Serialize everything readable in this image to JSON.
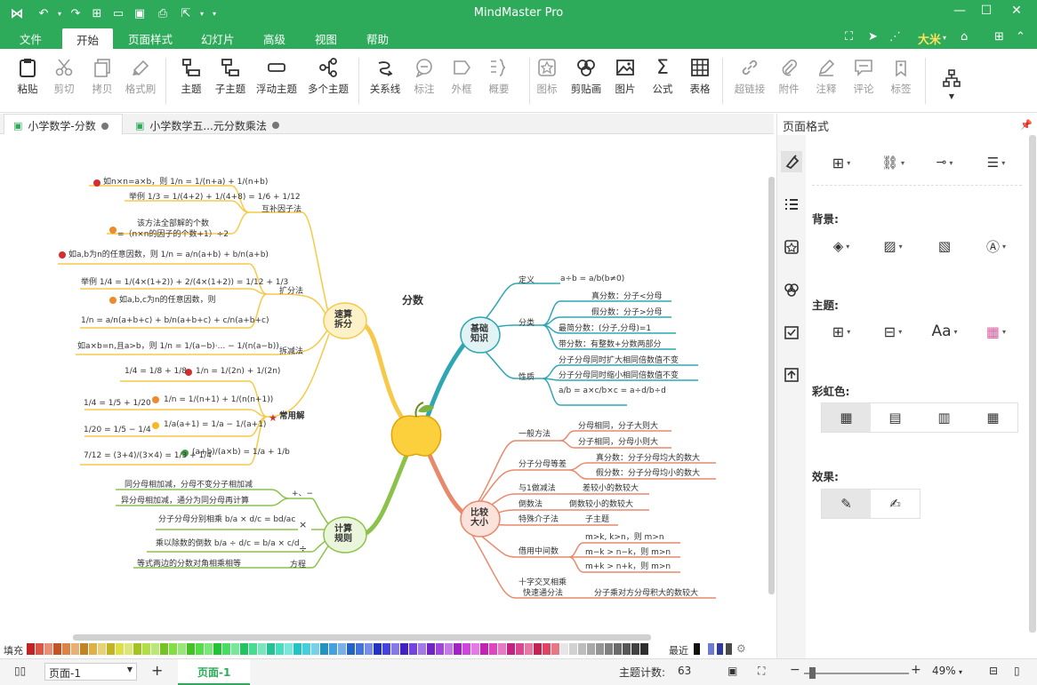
{
  "app": {
    "title": "MindMaster Pro",
    "user": "大米"
  },
  "menu": {
    "items": [
      "文件",
      "开始",
      "页面样式",
      "幻灯片",
      "高级",
      "视图",
      "帮助"
    ],
    "active": 1
  },
  "ribbon": {
    "buttons": [
      {
        "label": "粘贴",
        "icon": "clipboard-icon",
        "disabled": false
      },
      {
        "label": "剪切",
        "icon": "scissors-icon",
        "disabled": true
      },
      {
        "label": "拷贝",
        "icon": "copy-icon",
        "disabled": true
      },
      {
        "label": "格式刷",
        "icon": "format-brush-icon",
        "disabled": true
      },
      {
        "label": "主题",
        "icon": "topic-icon",
        "disabled": false
      },
      {
        "label": "子主题",
        "icon": "subtopic-icon",
        "disabled": false
      },
      {
        "label": "浮动主题",
        "icon": "floating-topic-icon",
        "disabled": false
      },
      {
        "label": "多个主题",
        "icon": "multiple-topics-icon",
        "disabled": false
      },
      {
        "label": "关系线",
        "icon": "relationship-icon",
        "disabled": false
      },
      {
        "label": "标注",
        "icon": "callout-icon",
        "disabled": true
      },
      {
        "label": "外框",
        "icon": "boundary-icon",
        "disabled": true
      },
      {
        "label": "概要",
        "icon": "summary-icon",
        "disabled": true
      },
      {
        "label": "图标",
        "icon": "mark-icon",
        "disabled": true
      },
      {
        "label": "剪贴画",
        "icon": "clipart-icon",
        "disabled": false
      },
      {
        "label": "图片",
        "icon": "picture-icon",
        "disabled": false
      },
      {
        "label": "公式",
        "icon": "formula-icon",
        "disabled": false
      },
      {
        "label": "表格",
        "icon": "table-icon",
        "disabled": false
      },
      {
        "label": "超链接",
        "icon": "hyperlink-icon",
        "disabled": true
      },
      {
        "label": "附件",
        "icon": "attachment-icon",
        "disabled": true
      },
      {
        "label": "注释",
        "icon": "note-icon",
        "disabled": true
      },
      {
        "label": "评论",
        "icon": "comment-icon",
        "disabled": true
      },
      {
        "label": "标签",
        "icon": "tag-icon",
        "disabled": true
      }
    ]
  },
  "doc_tabs": [
    {
      "label": "小学数学-分数",
      "active": true
    },
    {
      "label": "小学数学五...元分数乘法",
      "active": false
    }
  ],
  "panel": {
    "title": "页面格式",
    "sections": {
      "background": "背景:",
      "theme": "主题:",
      "rainbow": "彩虹色:",
      "effect": "效果:"
    }
  },
  "mindmap": {
    "center": "分数",
    "branches": {
      "basic": "基础\n知识",
      "split": "速算\n拆分",
      "rules": "计算\n规则",
      "compare": "比较\n大小"
    },
    "basic_items": {
      "def": "定义",
      "def_val": "a÷b = a/b(b≠0)",
      "class": "分类",
      "class_1": "真分数：分子<分母",
      "class_2": "假分数：分子>分母",
      "class_3": "最简分数：(分子,分母)=1",
      "class_4": "带分数：有整数+分数两部分",
      "prop": "性质",
      "prop_1": "分子分母同时扩大相同倍数值不变",
      "prop_2": "分子分母同时缩小相同倍数值不变",
      "prop_3": "a/b = a×c/b×c = a÷d/b÷d"
    },
    "split_items": {
      "f1": "互补因子法",
      "f1_1": "如n×n=a×b，则 1/n = 1/(n+a) + 1/(n+b)",
      "f1_2": "举例 1/3 = 1/(4+2) + 1/(4+8) = 1/6 + 1/12",
      "f1_3": "该方法全部解的个数",
      "f1_4": "=（n×n的因子的个数+1）÷2",
      "f2": "扩分法",
      "f2_1": "如a,b为n的任意因数，则 1/n = a/n(a+b) + b/n(a+b)",
      "f2_2": "举例 1/4 = 1/(4×(1+2)) + 2/(4×(1+2)) = 1/12 + 1/3",
      "f2_3": "如a,b,c为n的任意因数，则",
      "f2_4": "1/n = a/n(a+b+c) + b/n(a+b+c) + c/n(a+b+c)",
      "f3": "拆减法",
      "f3_1": "如a×b=n,且a>b，则 1/n = 1/(a−b)·... − 1/(n(a−b))",
      "f4": "常用解",
      "f4_1": "1/4 = 1/8 + 1/8",
      "f4_1b": "1/n = 1/(2n) + 1/(2n)",
      "f4_2": "1/4 = 1/5 + 1/20",
      "f4_2b": "1/n = 1/(n+1) + 1/(n(n+1))",
      "f4_3": "1/20 = 1/5 − 1/4",
      "f4_3b": "1/a(a+1) = 1/a − 1/(a+1)",
      "f4_4": "7/12 = (3+4)/(3×4) = 1/3 + 1/4",
      "f4_4b": "(a+b)/(a×b) = 1/a + 1/b"
    },
    "rule_items": {
      "r1": "+、−",
      "r1_1": "同分母相加减，分母不变分子相加减",
      "r1_2": "异分母相加减，通分为同分母再计算",
      "r2": "×",
      "r2_1": "分子分母分别相乘 b/a × d/c = bd/ac",
      "r3": "÷",
      "r3_1": "乘以除数的倒数 b/a ÷ d/c = b/a × c/d",
      "r4": "方程",
      "r4_1": "等式两边的分数对角相乘相等"
    },
    "compare_items": {
      "c1": "一般方法",
      "c1_1": "分母相同，分子大则大",
      "c1_2": "分子相同，分母小则大",
      "c2": "分子分母等差",
      "c2_1": "真分数：分子分母均大的数大",
      "c2_2": "假分数：分子分母均小的数大",
      "c3": "与1做减法",
      "c3_1": "差较小的数较大",
      "c4": "倒数法",
      "c4_1": "倒数较小的数较大",
      "c5": "特殊介子法",
      "c5_1": "子主题",
      "c6": "借用中间数",
      "c6_1": "m>k, k>n，则 m>n",
      "c6_2": "m−k > n−k，则 m>n",
      "c6_3": "m+k > n+k，则 m>n",
      "c7": "十字交叉相乘",
      "c7b": "快速通分法",
      "c7_1": "分子乘对方分母积大的数较大"
    }
  },
  "status": {
    "fill_label": "填充",
    "recent_label": "最近",
    "page_select": "页面-1",
    "page_tab": "页面-1",
    "topic_count_label": "主题计数:",
    "topic_count": "63",
    "zoom": "49%"
  },
  "colors": {
    "brand": "#2dab5b",
    "yellow": "#f7c948",
    "teal": "#2fa7b3",
    "green": "#8bc34a",
    "salmon": "#e8896d"
  }
}
